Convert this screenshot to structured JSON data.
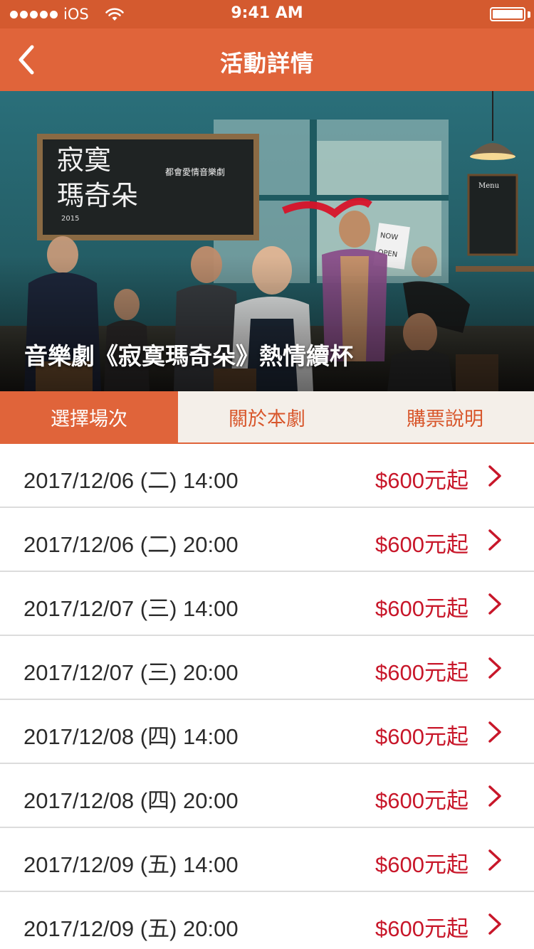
{
  "status_bar": {
    "carrier": "iOS",
    "time": "9:41 AM"
  },
  "nav": {
    "title": "活動詳情",
    "back_icon": "chevron-left-icon"
  },
  "hero": {
    "caption": "音樂劇《寂寞瑪奇朵》熱情續杯",
    "poster_title": "寂寞瑪奇朵",
    "poster_subtitle": "都會愛情音樂劇",
    "poster_year": "2015",
    "sign_text": "NOW OPEN",
    "menu_text": "Menu"
  },
  "tabs": [
    {
      "label": "選擇場次",
      "active": true
    },
    {
      "label": "關於本劇",
      "active": false
    },
    {
      "label": "購票說明",
      "active": false
    }
  ],
  "sessions": [
    {
      "date": "2017/12/06 (二) 14:00",
      "price": "$600元起"
    },
    {
      "date": "2017/12/06 (二) 20:00",
      "price": "$600元起"
    },
    {
      "date": "2017/12/07 (三) 14:00",
      "price": "$600元起"
    },
    {
      "date": "2017/12/07 (三) 20:00",
      "price": "$600元起"
    },
    {
      "date": "2017/12/08 (四) 14:00",
      "price": "$600元起"
    },
    {
      "date": "2017/12/08 (四) 20:00",
      "price": "$600元起"
    },
    {
      "date": "2017/12/09 (五) 14:00",
      "price": "$600元起"
    },
    {
      "date": "2017/12/09 (五) 20:00",
      "price": "$600元起"
    }
  ],
  "colors": {
    "accent": "#e0643a",
    "status_bar": "#d45a2f",
    "price": "#c8172a",
    "tab_inactive_bg": "#f4efe9"
  }
}
